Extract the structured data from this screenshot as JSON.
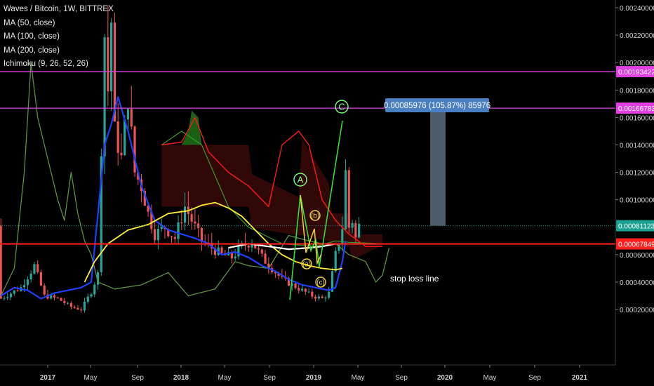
{
  "legend": {
    "title": "Waves / Bitcoin, 1W, BITTREX",
    "indicators": [
      "MA (50, close)",
      "MA (100, close)",
      "MA (200, close)",
      "Ichimoku (9, 26, 52, 26)"
    ]
  },
  "colors": {
    "background": "#000000",
    "up_candle": "#26a69a",
    "down_candle": "#ef5350",
    "ma_blue": "#1f3fff",
    "ma_yellow": "#ffee33",
    "ma_white": "#ffffff",
    "cloud_red": "#ff1a1a",
    "cloud_green": "#3a9d23",
    "lagging_green": "#5f8f3f",
    "magenta_line": "#e040e0",
    "stop_loss_line": "#ff1f1f",
    "wave_line": "#33dd33",
    "measure_box": "#5a6b7d",
    "measure_label_bg": "#4a7fc1",
    "current_price_bg": "#1aa090"
  },
  "annotations": {
    "measure_label": "0.00085976 (105.87%) 85976",
    "stop_loss_text": "stop loss line",
    "wave_labels": [
      "A",
      "C",
      "(a)",
      "(b)",
      "(c)"
    ]
  },
  "chart_data": {
    "type": "candlestick",
    "title": "Waves / Bitcoin, 1W, BITTREX",
    "x_ticks": [
      "2017",
      "May",
      "Sep",
      "2018",
      "May",
      "Sep",
      "2019",
      "May",
      "Sep",
      "2020",
      "May",
      "Sep",
      "2021"
    ],
    "y_ticks": [
      "0.00240000",
      "0.00220000",
      "0.00200000",
      "0.00180000",
      "0.00160000",
      "0.00140000",
      "0.00120000",
      "0.00100000",
      "0.00080000",
      "0.00060000",
      "0.00040000",
      "0.00020000"
    ],
    "y_ticks_values": [
      0.0024,
      0.0022,
      0.002,
      0.0018,
      0.0016,
      0.0014,
      0.0012,
      0.001,
      0.0008,
      0.0006,
      0.0004,
      0.0002
    ],
    "ylim": [
      8e-05,
      0.00248
    ],
    "price_badges": [
      {
        "label": "0.00193422",
        "value": 0.00193422,
        "kind": "magenta"
      },
      {
        "label": "0.00166783",
        "value": 0.00166783,
        "kind": "magenta"
      },
      {
        "label": "0.00081123",
        "value": 0.00081123,
        "kind": "current"
      },
      {
        "label": "0.00067849",
        "value": 0.00067849,
        "kind": "red"
      }
    ],
    "horizontal_lines": [
      {
        "value": 0.00193422,
        "kind": "magenta"
      },
      {
        "value": 0.00166783,
        "kind": "magenta"
      },
      {
        "value": 0.00067849,
        "kind": "red"
      }
    ],
    "measure_range": [
      0.00081123,
      0.00166783
    ]
  }
}
